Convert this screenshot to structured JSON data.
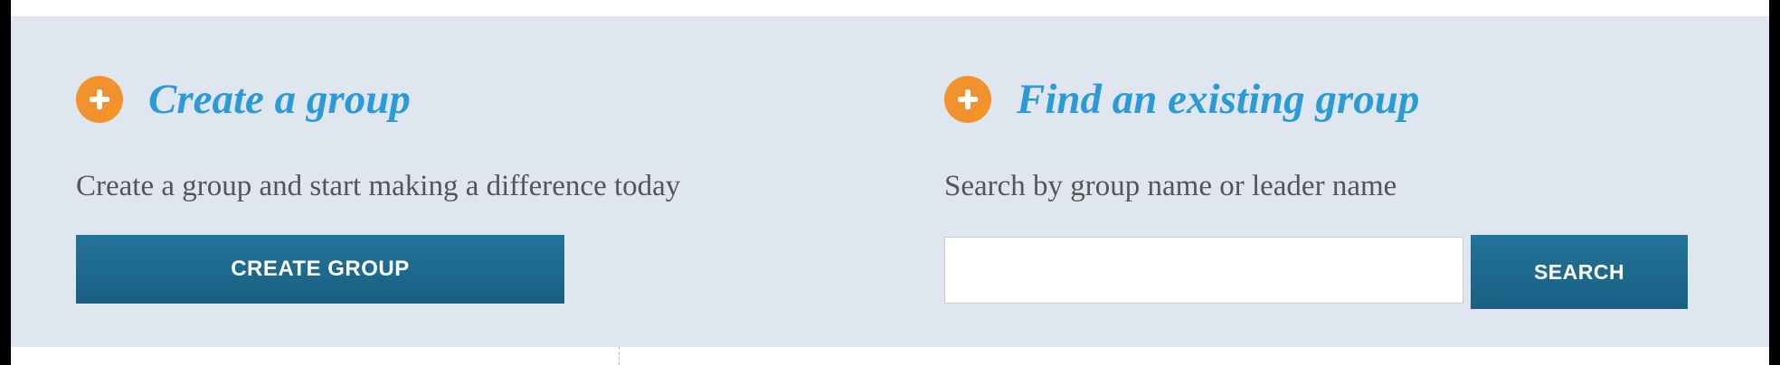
{
  "create": {
    "icon": "plus-circle-icon",
    "heading": "Create a group",
    "subtext": "Create a group and start making a difference today",
    "button_label": "CREATE GROUP"
  },
  "find": {
    "icon": "plus-circle-icon",
    "heading": "Find an existing group",
    "subtext": "Search by group name or leader name",
    "search_value": "",
    "search_placeholder": "",
    "button_label": "SEARCH"
  },
  "colors": {
    "panel_background": "#e0e6f0",
    "heading": "#2a9bd6",
    "icon": "#f3922d",
    "button": "#1f6a8e",
    "body_text": "#555555"
  }
}
